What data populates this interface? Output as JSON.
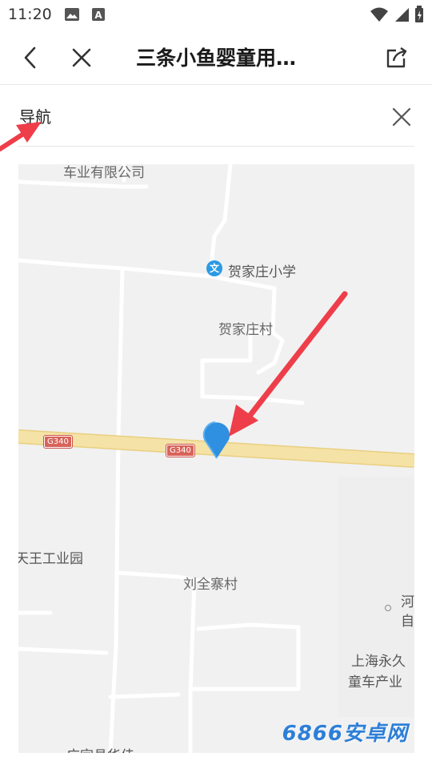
{
  "status_bar": {
    "time": "11:20"
  },
  "app_bar": {
    "title": "三条小鱼婴童用…"
  },
  "panel": {
    "title": "导航"
  },
  "map": {
    "labels": {
      "company_top": "车业有限公司",
      "school": "贺家庄小学",
      "school_badge": "文",
      "village_he": "贺家庄村",
      "industrial_park": "天王工业园",
      "village_liu": "刘全寨村",
      "he_char": "河",
      "zi_char": "自",
      "shanghai_line1": "上海永久",
      "shanghai_line2": "童车产业",
      "bottom_partial": "广宗县华佳"
    },
    "road_badges": [
      "G340",
      "G340"
    ]
  },
  "watermark": "6866安卓网",
  "colors": {
    "marker": "#2f8fe0",
    "arrow": "#ee3e4a",
    "highway": "#f5e2a6",
    "road_badge": "#d8635a"
  }
}
